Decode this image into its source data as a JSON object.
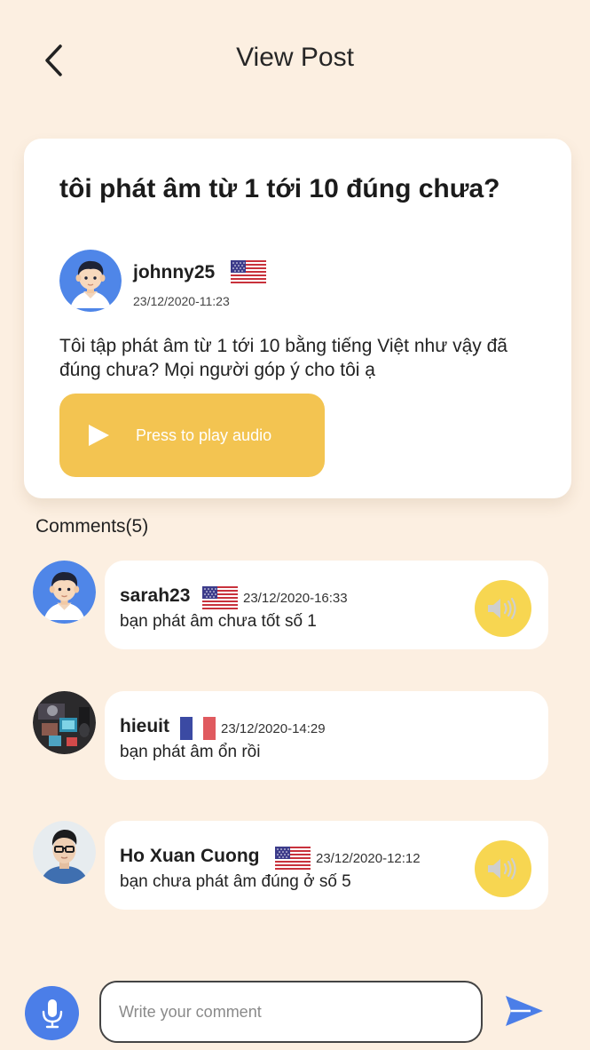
{
  "header": {
    "title": "View Post",
    "back_icon": "chevron-left-icon"
  },
  "post": {
    "title": "tôi phát âm từ 1 tới 10 đúng chưa?",
    "username": "johnny25",
    "flag": "us-flag-icon",
    "timestamp": "23/12/2020-11:23",
    "body": "Tôi tập phát âm từ 1 tới 10 bằng tiếng Việt như vậy đã đúng chưa? Mọi người góp ý cho tôi ạ",
    "play_label": "Press to play audio",
    "play_icon": "play-icon"
  },
  "comments_header": "Comments(5)",
  "comments": [
    {
      "username": "sarah23",
      "flag": "us-flag-icon",
      "timestamp": "23/12/2020-16:33",
      "text": "bạn phát âm chưa tốt số 1",
      "has_audio": true
    },
    {
      "username": "hieuit",
      "flag": "fr-flag-icon",
      "timestamp": "23/12/2020-14:29",
      "text": "bạn phát âm ổn rồi",
      "has_audio": false
    },
    {
      "username": "Ho Xuan Cuong",
      "flag": "us-flag-icon",
      "timestamp": "23/12/2020-12:12",
      "text": "bạn chưa phát âm đúng ở số 5",
      "has_audio": true
    }
  ],
  "composer": {
    "placeholder": "Write your comment",
    "value": "",
    "mic_icon": "microphone-icon",
    "send_icon": "send-icon"
  },
  "colors": {
    "background": "#fcefe1",
    "play_button": "#f3c451",
    "speaker_button": "#f7d651",
    "mic_button": "#4b7ee8",
    "send_icon": "#4b7ee8"
  }
}
